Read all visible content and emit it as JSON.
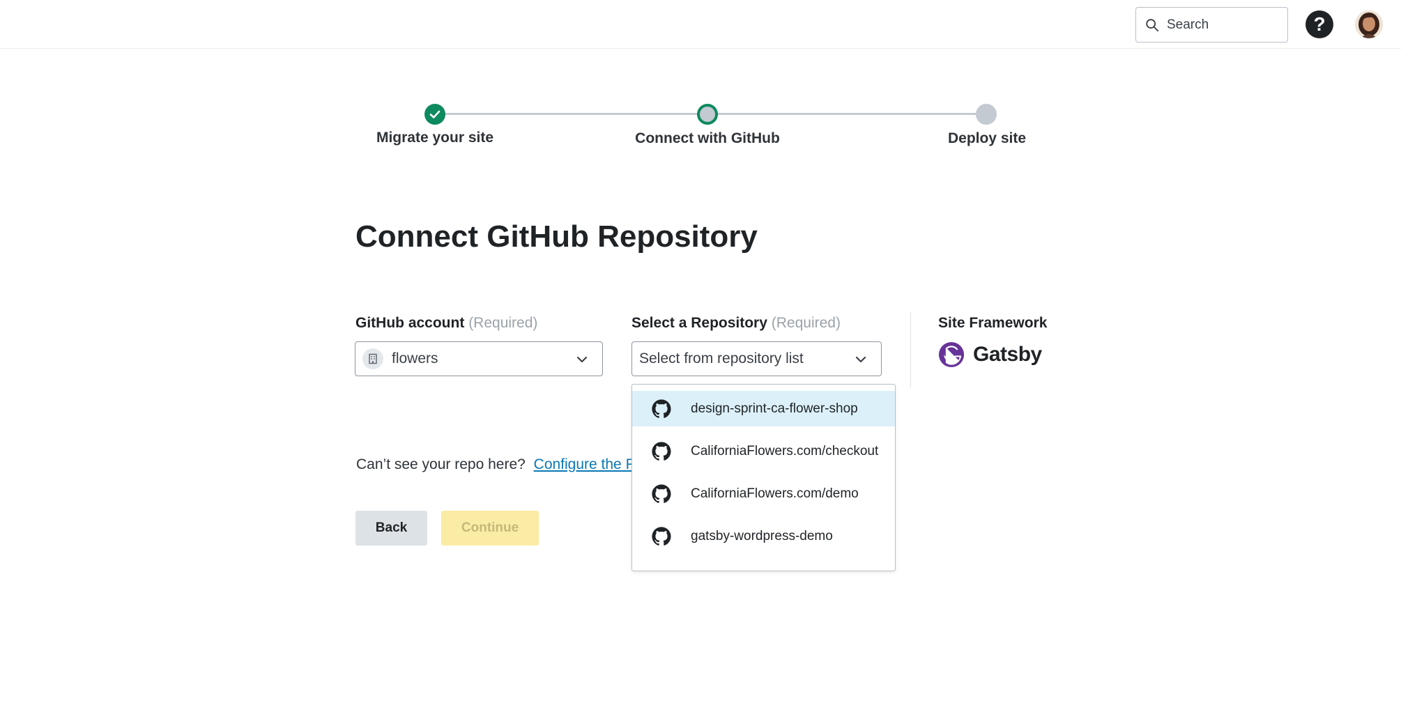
{
  "header": {
    "search_placeholder": "Search",
    "help_glyph": "?",
    "icons": {
      "search": "search-icon",
      "help": "help-icon",
      "avatar": "user-avatar"
    }
  },
  "stepper": {
    "steps": [
      {
        "label": "Migrate your site",
        "state": "complete"
      },
      {
        "label": "Connect with GitHub",
        "state": "current"
      },
      {
        "label": "Deploy site",
        "state": "upcoming"
      }
    ],
    "colors": {
      "complete": "#0e8a5f",
      "current_ring": "#0e8a5f",
      "current_fill": "#c3cad1",
      "upcoming": "#c3cad1",
      "line": "#c3cad1"
    }
  },
  "page": {
    "title": "Connect GitHub Repository"
  },
  "github_account": {
    "label": "GitHub account",
    "required": "(Required)",
    "value": "flowers",
    "icon": "building-icon"
  },
  "repository": {
    "label": "Select a Repository",
    "required": "(Required)",
    "placeholder": "Select from repository list",
    "options": [
      {
        "label": "design-sprint-ca-flower-shop",
        "highlighted": true
      },
      {
        "label": "CaliforniaFlowers.com/checkout",
        "highlighted": false
      },
      {
        "label": "CaliforniaFlowers.com/demo",
        "highlighted": false
      },
      {
        "label": "gatsby-wordpress-demo",
        "highlighted": false
      }
    ],
    "option_icon": "github-icon"
  },
  "framework": {
    "label": "Site Framework",
    "name": "Gatsby",
    "icon": "gatsby-logo-icon",
    "color": "#663399"
  },
  "help": {
    "question": "Can’t see your repo here?",
    "link_visible": "Configure the F"
  },
  "actions": {
    "back": "Back",
    "continue": "Continue"
  }
}
